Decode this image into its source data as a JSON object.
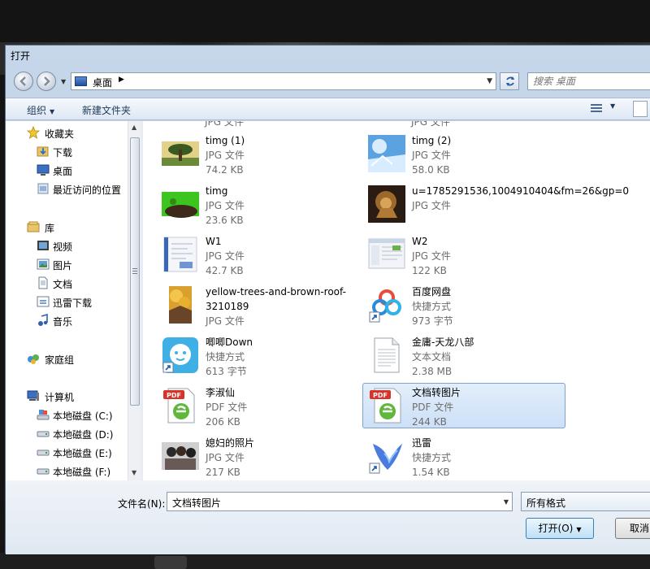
{
  "window": {
    "title": "打开"
  },
  "nav": {
    "breadcrumb": "桌面",
    "search_placeholder": "搜索 桌面"
  },
  "toolbar": {
    "organize": "组织",
    "new_folder": "新建文件夹"
  },
  "sidebar": {
    "favorites": {
      "label": "收藏夹",
      "items": [
        "下载",
        "桌面",
        "最近访问的位置"
      ]
    },
    "libraries": {
      "label": "库",
      "items": [
        "视频",
        "图片",
        "文档",
        "迅雷下载",
        "音乐"
      ]
    },
    "homegroup": {
      "label": "家庭组"
    },
    "computer": {
      "label": "计算机",
      "items": [
        "本地磁盘 (C:)",
        "本地磁盘 (D:)",
        "本地磁盘 (E:)",
        "本地磁盘 (F:)"
      ]
    }
  },
  "files": {
    "partial_top": [
      "JPG 文件",
      "JPG 文件"
    ],
    "items": [
      {
        "name": "timg (1)",
        "type": "JPG 文件",
        "size": "74.2 KB",
        "icon": "tree-photo-thumb"
      },
      {
        "name": "timg (2)",
        "type": "JPG 文件",
        "size": "58.0 KB",
        "icon": "sky-photo-thumb"
      },
      {
        "name": "timg",
        "type": "JPG 文件",
        "size": "23.6 KB",
        "icon": "green-photo-thumb"
      },
      {
        "name": "u=1785291536,1004910404&fm=26&gp=0",
        "type": "JPG 文件",
        "size": "",
        "icon": "lion-photo-thumb"
      },
      {
        "name": "W1",
        "type": "JPG 文件",
        "size": "42.7 KB",
        "icon": "document-photo-thumb"
      },
      {
        "name": "W2",
        "type": "JPG 文件",
        "size": "122 KB",
        "icon": "screenshot-photo-thumb"
      },
      {
        "name": "yellow-trees-and-brown-roof-3210189",
        "type": "JPG 文件",
        "size": "",
        "icon": "yellow-trees-thumb"
      },
      {
        "name": "百度网盘",
        "type": "快捷方式",
        "size": "973 字节",
        "icon": "baidu-netdisk-icon"
      },
      {
        "name": "唧唧Down",
        "type": "快捷方式",
        "size": "613 字节",
        "icon": "jijidown-icon"
      },
      {
        "name": "金庸-天龙八部",
        "type": "文本文档",
        "size": "2.38 MB",
        "icon": "text-document-icon"
      },
      {
        "name": "李淑仙",
        "type": "PDF 文件",
        "size": "206 KB",
        "icon": "pdf-icon"
      },
      {
        "name": "文档转图片",
        "type": "PDF 文件",
        "size": "244 KB",
        "icon": "pdf-icon",
        "selected": true
      },
      {
        "name": "媳妇的照片",
        "type": "JPG 文件",
        "size": "217 KB",
        "icon": "people-photo-thumb"
      },
      {
        "name": "迅雷",
        "type": "快捷方式",
        "size": "1.54 KB",
        "icon": "xunlei-icon"
      }
    ]
  },
  "footer": {
    "filename_label": "文件名(N):",
    "filename_value": "文档转图片",
    "filetype_value": "所有格式",
    "open_label": "打开(O)",
    "cancel_label": "取消"
  },
  "colors": {
    "selection_bg": "#cde0f7",
    "selection_border": "#7da2ce",
    "toolbar_text": "#1e395b",
    "meta_text": "#6d6d6d"
  }
}
